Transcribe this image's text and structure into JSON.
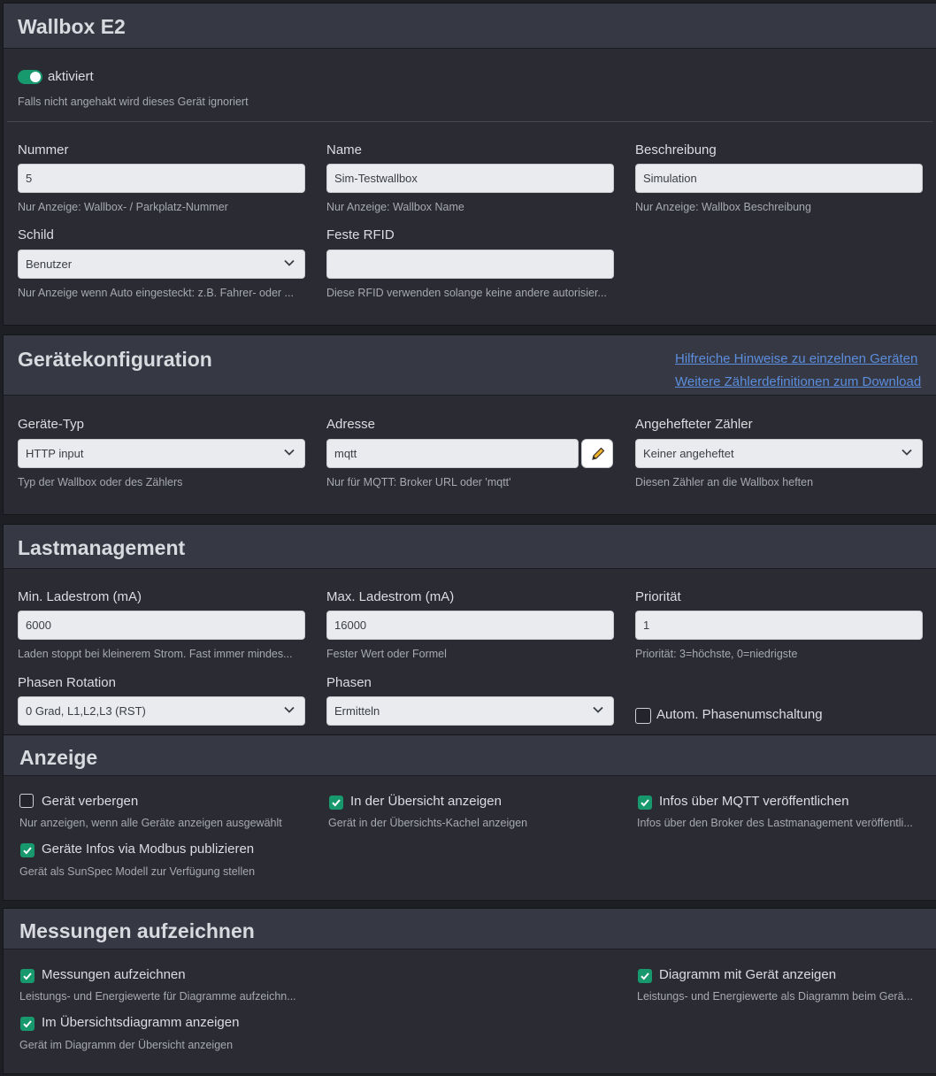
{
  "wallbox": {
    "title": "Wallbox E2",
    "enabled_label": "aktiviert",
    "enabled_help": "Falls nicht angehakt wird dieses Gerät ignoriert",
    "enabled": true,
    "nummer": {
      "label": "Nummer",
      "value": "5",
      "help": "Nur Anzeige: Wallbox- / Parkplatz-Nummer"
    },
    "name": {
      "label": "Name",
      "value": "Sim-Testwallbox",
      "help": "Nur Anzeige: Wallbox Name"
    },
    "beschreibung": {
      "label": "Beschreibung",
      "value": "Simulation",
      "help": "Nur Anzeige: Wallbox Beschreibung"
    },
    "schild": {
      "label": "Schild",
      "value": "Benutzer",
      "help": "Nur Anzeige wenn Auto eingesteckt: z.B. Fahrer- oder ..."
    },
    "rfid": {
      "label": "Feste RFID",
      "value": "",
      "help": "Diese RFID verwenden solange keine andere autorisier..."
    }
  },
  "geraetekonfig": {
    "title": "Gerätekonfiguration",
    "link1": "Hilfreiche Hinweise zu einzelnen Geräten",
    "link2": "Weitere Zählerdefinitionen zum Download",
    "typ": {
      "label": "Geräte-Typ",
      "value": "HTTP input",
      "help": "Typ der Wallbox oder des Zählers"
    },
    "adresse": {
      "label": "Adresse",
      "value": "mqtt",
      "help": "Nur für MQTT: Broker URL oder 'mqtt'"
    },
    "zaehler": {
      "label": "Angehefteter Zähler",
      "value": "Keiner angeheftet",
      "help": "Diesen Zähler an die Wallbox heften"
    }
  },
  "lastmanagement": {
    "title": "Lastmanagement",
    "min": {
      "label": "Min. Ladestrom (mA)",
      "value": "6000",
      "help": "Laden stoppt bei kleinerem Strom. Fast immer mindes..."
    },
    "max": {
      "label": "Max. Ladestrom (mA)",
      "value": "16000",
      "help": "Fester Wert oder Formel"
    },
    "prio": {
      "label": "Priorität",
      "value": "1",
      "help": "Priorität: 3=höchste, 0=niedrigste"
    },
    "rotation": {
      "label": "Phasen Rotation",
      "value": "0 Grad, L1,L2,L3 (RST)"
    },
    "phasen": {
      "label": "Phasen",
      "value": "Ermitteln"
    },
    "autom": {
      "label": "Autom. Phasenumschaltung",
      "checked": false
    }
  },
  "anzeige": {
    "title": "Anzeige",
    "verbergen": {
      "label": "Gerät verbergen",
      "help": "Nur anzeigen, wenn alle Geräte anzeigen ausgewählt",
      "checked": false
    },
    "uebersicht": {
      "label": "In der Übersicht anzeigen",
      "help": "Gerät in der Übersichts-Kachel anzeigen",
      "checked": true
    },
    "mqtt": {
      "label": "Infos über MQTT veröffentlichen",
      "help": "Infos über den Broker des Lastmanagement veröffentli...",
      "checked": true
    },
    "modbus": {
      "label": "Geräte Infos via Modbus publizieren",
      "help": "Gerät als SunSpec Modell zur Verfügung stellen",
      "checked": true
    }
  },
  "messungen": {
    "title": "Messungen aufzeichnen",
    "aufzeichnen": {
      "label": "Messungen aufzeichnen",
      "help": "Leistungs- und Energiewerte für Diagramme aufzeichn...",
      "checked": true
    },
    "diagramm": {
      "label": "Diagramm mit Gerät anzeigen",
      "help": "Leistungs- und Energiewerte als Diagramm beim Gerä...",
      "checked": true
    },
    "uebersichtsdiagramm": {
      "label": "Im Übersichtsdiagramm anzeigen",
      "help": "Gerät im Diagramm der Übersicht anzeigen",
      "checked": true
    }
  },
  "colors": {
    "accent": "#17986d",
    "link": "#5b8ede",
    "card": "#2a2b33",
    "header": "#363843"
  }
}
